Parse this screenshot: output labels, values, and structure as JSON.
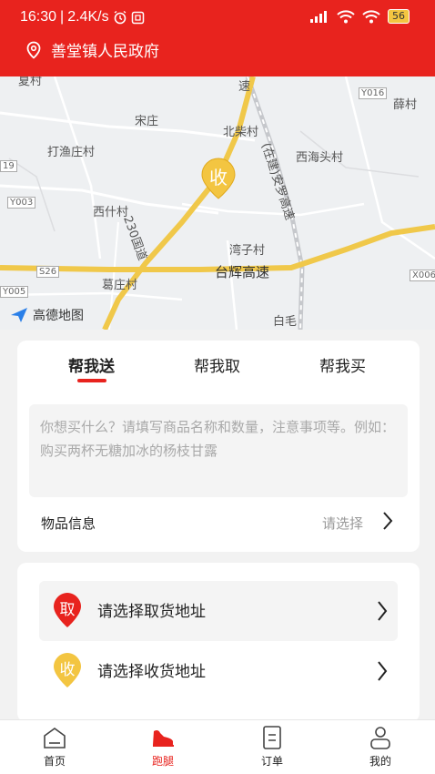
{
  "status_bar": {
    "time": "16:30",
    "network_speed": "2.4K/s",
    "battery": "56"
  },
  "header": {
    "location": "善堂镇人民政府",
    "icon": "location-pin-icon"
  },
  "map": {
    "marker_label": "收",
    "labels": {
      "songzhuang": "宋庄",
      "beichaicun": "北柴村",
      "xuecun": "薛村",
      "dayuzhuangcun": "打渔庄村",
      "xihaitoucun": "西海头村",
      "xishicun": "西什村",
      "wanzicun": "湾子村",
      "gezhuangcun": "葛庄村",
      "baimao": "白毛",
      "national_road": "230国道",
      "highway_taihui": "台辉高速",
      "highway_anluo": "(在建)安罗高速",
      "road_y016": "Y016",
      "road_y003": "Y003",
      "road_s26": "S26",
      "road_x006": "X006",
      "road_y005": "Y005",
      "edge_19": "19",
      "edge_suo": "速"
    },
    "brand": "高德地图"
  },
  "order_card": {
    "tabs": [
      {
        "label": "帮我送",
        "active": true
      },
      {
        "label": "帮我取",
        "active": false
      },
      {
        "label": "帮我买",
        "active": false
      }
    ],
    "textarea_placeholder": "你想买什么？请填写商品名称和数量，注意事项等。例如：购买两杯无糖加冰的杨枝甘露",
    "goods_label": "物品信息",
    "goods_value": "请选择"
  },
  "address_card": {
    "pickup": {
      "pin": "取",
      "label": "请选择取货地址",
      "color": "#e8231e"
    },
    "delivery": {
      "pin": "收",
      "label": "请选择收货地址",
      "color": "#f3c541"
    }
  },
  "bottom_nav": [
    {
      "label": "首页",
      "icon": "home-icon",
      "active": false
    },
    {
      "label": "跑腿",
      "icon": "errand-shoe-icon",
      "active": true
    },
    {
      "label": "订单",
      "icon": "order-icon",
      "active": false
    },
    {
      "label": "我的",
      "icon": "profile-icon",
      "active": false
    }
  ],
  "colors": {
    "brand_red": "#e8231e",
    "marker_yellow": "#f3c541"
  }
}
